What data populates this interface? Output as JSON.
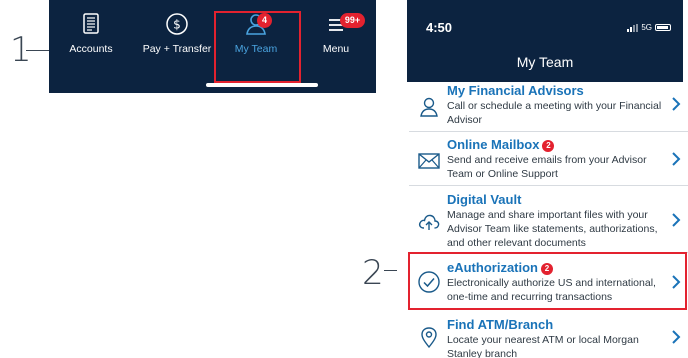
{
  "callouts": {
    "one": "1",
    "two": "2"
  },
  "tabbar": {
    "tabs": [
      {
        "label": "Accounts",
        "icon": "accounts-icon"
      },
      {
        "label": "Pay + Transfer",
        "icon": "dollar-circle-icon"
      },
      {
        "label": "My Team",
        "icon": "team-icon",
        "badge": "4",
        "active": true
      },
      {
        "label": "Menu",
        "icon": "menu-icon",
        "badge": "99+"
      }
    ]
  },
  "phone": {
    "time": "4:50",
    "network": "5G",
    "title": "My Team",
    "items": [
      {
        "title": "My Financial Advisors",
        "description": "Call or schedule a meeting with your Financial Advisor",
        "icon": "person-icon"
      },
      {
        "title": "Online Mailbox",
        "badge": "2",
        "description": "Send and receive emails from your Advisor Team or Online Support",
        "icon": "envelope-icon"
      },
      {
        "title": "Digital Vault",
        "description": "Manage and share important files with your Advisor Team like statements, authorizations, and other relevant documents",
        "icon": "cloud-upload-icon"
      },
      {
        "title": "eAuthorization",
        "badge": "2",
        "description": "Electronically authorize US and international, one-time and recurring transactions",
        "icon": "check-circle-icon"
      },
      {
        "title": "Find ATM/Branch",
        "description": "Locate your nearest ATM or local Morgan Stanley branch",
        "icon": "location-pin-icon"
      }
    ]
  },
  "colors": {
    "navy": "#0c2340",
    "accent_blue": "#1a73b8",
    "active_tab_blue": "#4aa3df",
    "highlight_red": "#e3222f"
  }
}
